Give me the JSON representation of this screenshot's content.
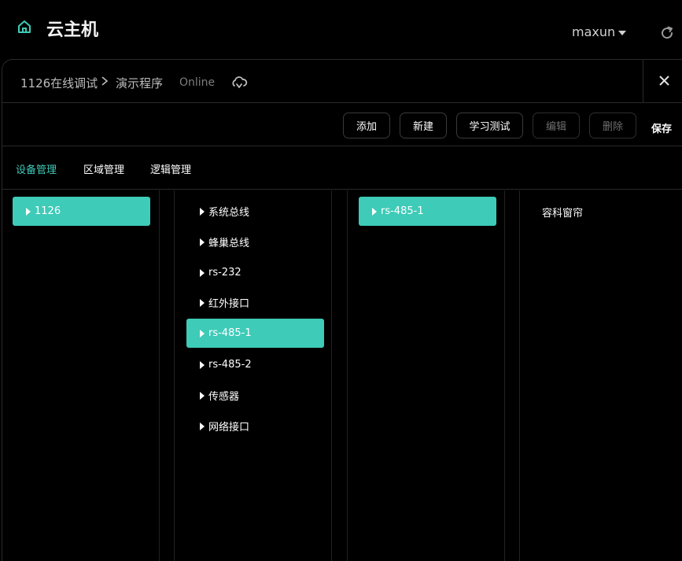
{
  "app": {
    "title": "云主机",
    "user": "maxun"
  },
  "breadcrumb": {
    "project": "1126在线调试",
    "program": "演示程序",
    "status": "Online"
  },
  "toolbar": {
    "add": "添加",
    "new": "新建",
    "learn_test": "学习测试",
    "edit": "编辑",
    "delete": "删除",
    "save": "保存"
  },
  "tabs": [
    {
      "label": "设备管理",
      "active": true
    },
    {
      "label": "区域管理",
      "active": false
    },
    {
      "label": "逻辑管理",
      "active": false
    }
  ],
  "columns": {
    "hosts": [
      {
        "label": "1126",
        "selected": true
      }
    ],
    "interfaces": [
      {
        "label": "系统总线",
        "selected": false
      },
      {
        "label": "蜂巢总线",
        "selected": false
      },
      {
        "label": "rs-232",
        "selected": false
      },
      {
        "label": "红外接口",
        "selected": false
      },
      {
        "label": "rs-485-1",
        "selected": true
      },
      {
        "label": "rs-485-2",
        "selected": false
      },
      {
        "label": "传感器",
        "selected": false
      },
      {
        "label": "网络接口",
        "selected": false
      }
    ],
    "buses": [
      {
        "label": "rs-485-1",
        "selected": true
      }
    ],
    "devices": [
      {
        "label": "容科窗帘"
      }
    ]
  },
  "colors": {
    "accent": "#3ecbb8",
    "background": "#000000"
  },
  "icons": {
    "home": "home-icon",
    "refresh": "refresh-icon",
    "cloud": "cloud-sync-icon",
    "close": "close-icon",
    "user_caret": "caret-down-icon"
  }
}
